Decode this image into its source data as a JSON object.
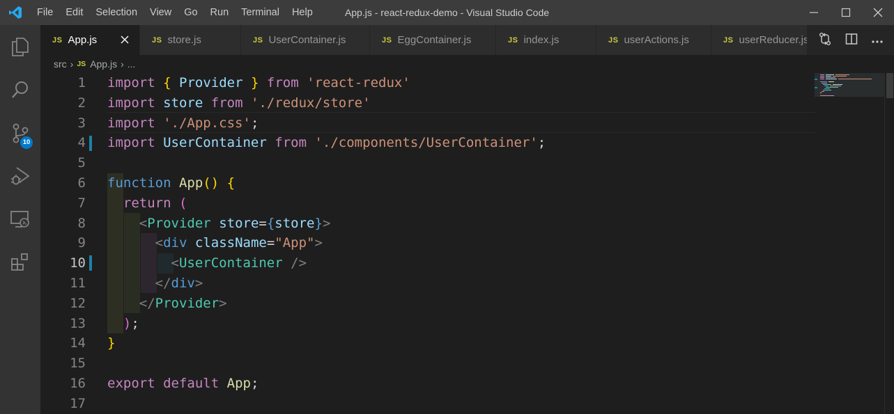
{
  "titlebar": {
    "menu": [
      "File",
      "Edit",
      "Selection",
      "View",
      "Go",
      "Run",
      "Terminal",
      "Help"
    ],
    "window_title": "App.js - react-redux-demo - Visual Studio Code"
  },
  "activity_bar": {
    "items": [
      "explorer-icon",
      "search-icon",
      "source-control-icon",
      "run-debug-icon",
      "remote-explorer-icon",
      "extensions-icon"
    ],
    "source_control_badge": "10"
  },
  "tabs": [
    {
      "label": "App.js",
      "active": true
    },
    {
      "label": "store.js",
      "active": false
    },
    {
      "label": "UserContainer.js",
      "active": false
    },
    {
      "label": "EggContainer.js",
      "active": false
    },
    {
      "label": "index.js",
      "active": false
    },
    {
      "label": "userActions.js",
      "active": false
    },
    {
      "label": "userReducer.js",
      "active": false
    }
  ],
  "tab_file_badge": "JS",
  "breadcrumb": {
    "folder": "src",
    "file": "App.js",
    "more": "..."
  },
  "editor": {
    "line_numbers": [
      "1",
      "2",
      "3",
      "4",
      "5",
      "6",
      "7",
      "8",
      "9",
      "10",
      "11",
      "12",
      "13",
      "14",
      "15",
      "16",
      "17"
    ],
    "current_line": 10,
    "modified_lines": [
      4,
      10
    ]
  },
  "colors": {
    "accent": "#007acc",
    "keyword": "#c586c0",
    "string": "#ce9178",
    "component": "#4ec9b0",
    "html_tag": "#569cd6",
    "variable": "#9cdcfe",
    "function": "#dcdcaa",
    "bracket_gold": "#ffd700"
  }
}
